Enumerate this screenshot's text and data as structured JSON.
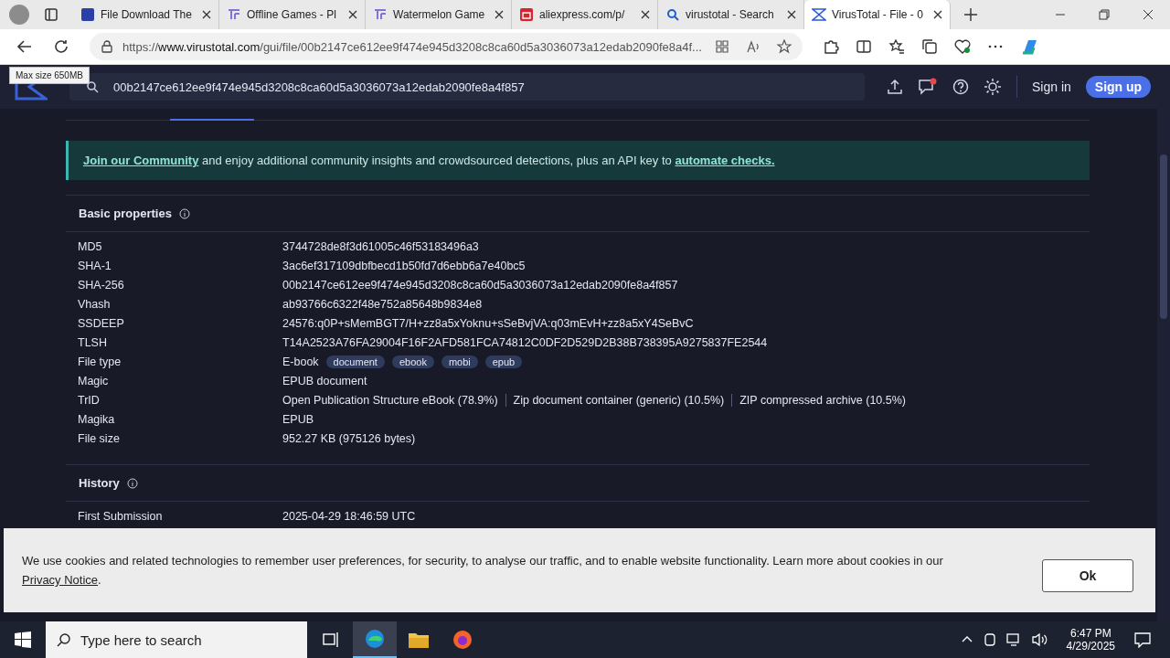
{
  "browser": {
    "tabs": [
      {
        "title": "File Download The",
        "selected": false
      },
      {
        "title": "Offline Games - Pl",
        "selected": false
      },
      {
        "title": "Watermelon Game",
        "selected": false
      },
      {
        "title": "aliexpress.com/p/",
        "selected": false
      },
      {
        "title": "virustotal - Search",
        "selected": false
      },
      {
        "title": "VirusTotal - File - 0",
        "selected": true
      }
    ],
    "url_prefix": "https://",
    "url_host": "www.virustotal.com",
    "url_path": "/gui/file/00b2147ce612ee9f474e945d3208c8ca60d5a3036073a12edab2090fe8a4f..."
  },
  "header": {
    "search_value": "00b2147ce612ee9f474e945d3208c8ca60d5a3036073a12edab2090fe8a4f857",
    "tooltip": "Max size 650MB",
    "sign_in": "Sign in",
    "sign_up": "Sign up"
  },
  "banner": {
    "link1": "Join our Community",
    "text": " and enjoy additional community insights and crowdsourced detections, plus an API key to ",
    "link2": "automate checks."
  },
  "basic": {
    "title": "Basic properties",
    "rows": [
      {
        "label": "MD5",
        "kind": "text",
        "value": "3744728de8f3d61005c46f53183496a3"
      },
      {
        "label": "SHA-1",
        "kind": "text",
        "value": "3ac6ef317109dbfbecd1b50fd7d6ebb6a7e40bc5"
      },
      {
        "label": "SHA-256",
        "kind": "text",
        "value": "00b2147ce612ee9f474e945d3208c8ca60d5a3036073a12edab2090fe8a4f857"
      },
      {
        "label": "Vhash",
        "kind": "text",
        "value": "ab93766c6322f48e752a85648b9834e8"
      },
      {
        "label": "SSDEEP",
        "kind": "text",
        "value": "24576:q0P+sMemBGT7/H+zz8a5xYoknu+sSeBvjVA:q03mEvH+zz8a5xY4SeBvC"
      },
      {
        "label": "TLSH",
        "kind": "text",
        "value": "T14A2523A76FA29004F16F2AFD581FCA74812C0DF2D529D2B38B738395A9275837FE2544"
      },
      {
        "label": "File type",
        "kind": "tags",
        "value": "E-book",
        "tags": [
          "document",
          "ebook",
          "mobi",
          "epub"
        ]
      },
      {
        "label": "Magic",
        "kind": "text",
        "value": "EPUB document"
      },
      {
        "label": "TrID",
        "kind": "list",
        "items": [
          "Open Publication Structure eBook (78.9%)",
          "Zip document container (generic) (10.5%)",
          "ZIP compressed archive (10.5%)"
        ]
      },
      {
        "label": "Magika",
        "kind": "text",
        "value": "EPUB"
      },
      {
        "label": "File size",
        "kind": "text",
        "value": "952.27 KB (975126 bytes)"
      }
    ]
  },
  "history": {
    "title": "History",
    "rows": [
      {
        "label": "First Submission",
        "value": "2025-04-29 18:46:59 UTC"
      }
    ]
  },
  "cookie": {
    "text": "We use cookies and related technologies to remember user preferences, for security, to analyse our traffic, and to enable website functionality. Learn more about cookies in our ",
    "link": "Privacy Notice",
    "end": ".",
    "button": "Ok"
  },
  "taskbar": {
    "search_placeholder": "Type here to search",
    "time": "6:47 PM",
    "date": "4/29/2025"
  }
}
